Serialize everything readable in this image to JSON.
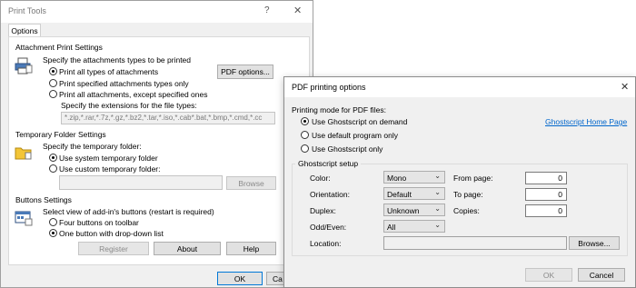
{
  "print_tools": {
    "title": "Print Tools",
    "help_glyph": "?",
    "close_glyph": "✕",
    "tab": "Options",
    "attach": {
      "heading": "Attachment Print Settings",
      "subtitle": "Specify the attachments types to be printed",
      "opt_all": "Print all types of attachments",
      "opt_specified": "Print specified attachments types only",
      "opt_except": "Print all attachments, except specified ones",
      "ext_label": "Specify the extensions for the file types:",
      "ext_value": "*.zip,*.rar,*.7z,*.gz,*.bz2,*.tar,*.iso,*.cab*.bat,*.bmp,*.cmd,*.cc",
      "pdf_button": "PDF options..."
    },
    "temp": {
      "heading": "Temporary Folder Settings",
      "subtitle": "Specify the temporary folder:",
      "opt_system": "Use system temporary folder",
      "opt_custom": "Use custom temporary folder:",
      "browse": "Browse"
    },
    "buttons": {
      "heading": "Buttons Settings",
      "subtitle": "Select view of add-in's buttons (restart is required)",
      "opt_four": "Four buttons on toolbar",
      "opt_one": "One button with drop-down list",
      "register": "Register",
      "about": "About",
      "help": "Help"
    },
    "ok": "OK",
    "cancel": "Ca"
  },
  "pdf_dialog": {
    "title": "PDF printing options",
    "close_glyph": "✕",
    "mode_label": "Printing mode for PDF files:",
    "opt_ghostscript_demand": "Use Ghostscript on demand",
    "opt_default_program": "Use default program only",
    "opt_ghostscript_only": "Use Ghostscript only",
    "homepage_link": "Ghostscript Home Page",
    "setup_heading": "Ghostscript setup",
    "color_label": "Color:",
    "color_value": "Mono",
    "orientation_label": "Orientation:",
    "orientation_value": "Default",
    "duplex_label": "Duplex:",
    "duplex_value": "Unknown",
    "oddeven_label": "Odd/Even:",
    "oddeven_value": "All",
    "from_label": "From page:",
    "from_value": "0",
    "to_label": "To page:",
    "to_value": "0",
    "copies_label": "Copies:",
    "copies_value": "0",
    "location_label": "Location:",
    "location_value": "",
    "browse": "Browse...",
    "ok": "OK",
    "cancel": "Cancel"
  },
  "colors": {
    "accent": "#0078d7",
    "link": "#0066cc"
  }
}
